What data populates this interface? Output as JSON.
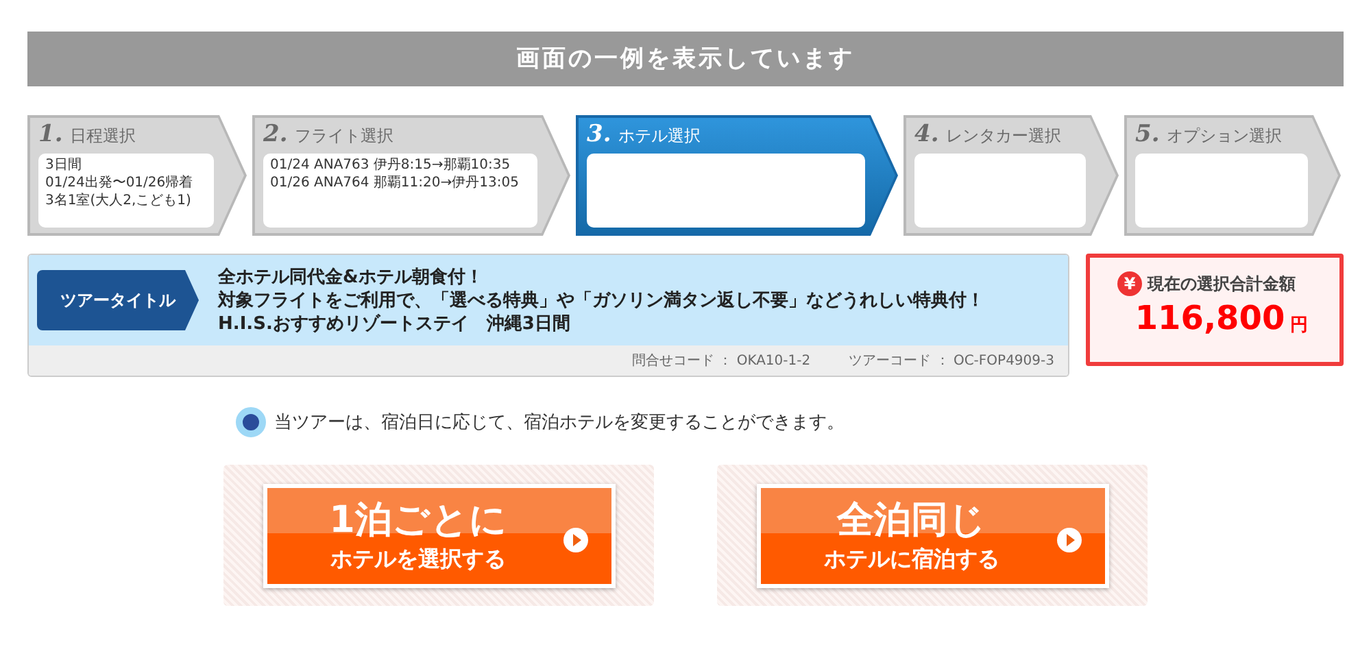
{
  "banner": {
    "title": "画面の一例を表示しています"
  },
  "steps": [
    {
      "number": "1.",
      "label": "日程選択",
      "selected": false,
      "details": [
        "3日間",
        "01/24出発〜01/26帰着",
        "3名1室(大人2,こども1)"
      ]
    },
    {
      "number": "2.",
      "label": "フライト選択",
      "selected": false,
      "details": [
        "01/24 ANA763 伊丹8:15→那覇10:35",
        "01/26 ANA764 那覇11:20→伊丹13:05"
      ]
    },
    {
      "number": "3.",
      "label": "ホテル選択",
      "selected": true
    },
    {
      "number": "4.",
      "label": "レンタカー選択",
      "selected": false
    },
    {
      "number": "5.",
      "label": "オプション選択",
      "selected": false
    }
  ],
  "tour": {
    "tag": "ツアータイトル",
    "lines": [
      "全ホテル同代金&ホテル朝食付！",
      "対象フライトをご利用で、「選べる特典」や「ガソリン満タン返し不要」などうれしい特典付！",
      "H.I.S.おすすめリゾートステイ　沖縄3日間"
    ],
    "codes": [
      "問合せコード ： OKA10-1-2",
      "ツアーコード ： OC-FOP4909-3"
    ]
  },
  "total": {
    "icon": "¥",
    "label": "現在の選択合計金額",
    "amount": "116,800",
    "unit": "円"
  },
  "notice": "当ツアーは、宿泊日に応じて、宿泊ホテルを変更することができます。",
  "choices": [
    {
      "main": "1泊ごとに",
      "sub": "ホテルを選択する"
    },
    {
      "main": "全泊同じ",
      "sub": "ホテルに宿泊する"
    }
  ]
}
